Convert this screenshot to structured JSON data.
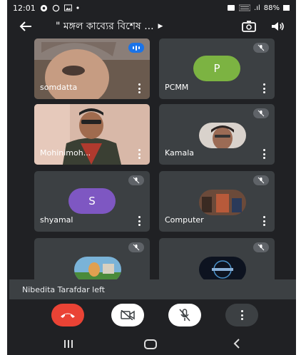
{
  "status_bar": {
    "time": "12:01",
    "signal_label": ".ıl",
    "battery": "88%"
  },
  "top_bar": {
    "title": "\" মঙ্গল কাব্যের বিশেষ ..."
  },
  "participants": [
    {
      "name": "somdatta",
      "status": "speaking"
    },
    {
      "name": "PCMM",
      "initial": "P",
      "avatar_color": "#7cb342",
      "status": "muted"
    },
    {
      "name": "Mohinimoh...",
      "status": "video"
    },
    {
      "name": "Kamala",
      "status": "muted"
    },
    {
      "name": "shyamal",
      "initial": "S",
      "avatar_color": "#7e57c2",
      "status": "muted"
    },
    {
      "name": "Computer",
      "status": "muted"
    },
    {
      "name": "",
      "status": "muted"
    },
    {
      "name": "",
      "status": "muted"
    }
  ],
  "toast": {
    "message": "Nibedita Tarafdar left"
  },
  "colors": {
    "background": "#202124",
    "tile": "#3c4043",
    "end_call": "#ea4335",
    "speaking_indicator": "#1a73e8"
  }
}
